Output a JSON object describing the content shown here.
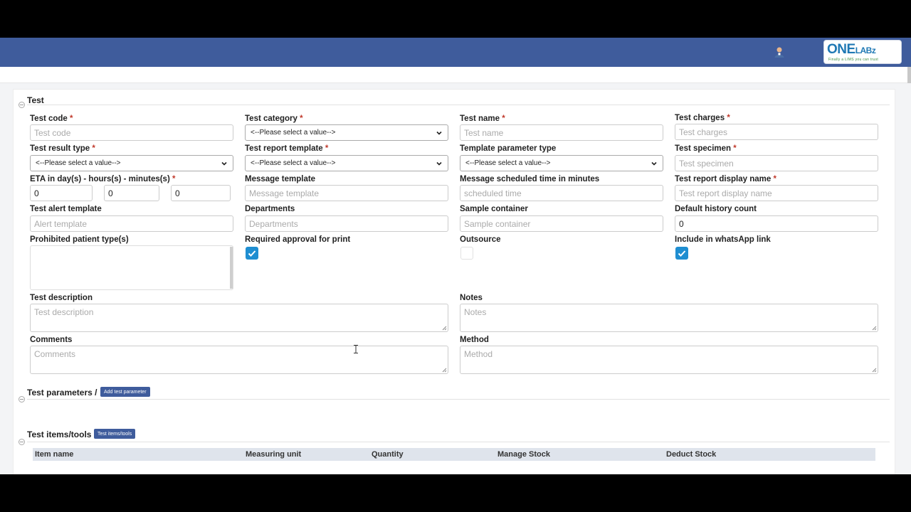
{
  "header": {
    "logo_text": "ONE",
    "logo_suffix": "LABz",
    "logo_tagline": "Finally a LIMS you can trust",
    "colors": {
      "topbar": "#3f5c9c",
      "accent": "#1f8ed1",
      "required": "#c0392b"
    }
  },
  "test_section": {
    "legend": "Test",
    "fields": {
      "test_code": {
        "label": "Test code",
        "placeholder": "Test code"
      },
      "test_category": {
        "label": "Test category",
        "value": "<--Please select a value-->"
      },
      "test_name": {
        "label": "Test name",
        "placeholder": "Test name"
      },
      "test_charges": {
        "label": "Test charges",
        "placeholder": "Test charges"
      },
      "test_result_type": {
        "label": "Test result type",
        "value": "<--Please select a value-->"
      },
      "test_report_template": {
        "label": "Test report template",
        "value": "<--Please select a value-->"
      },
      "template_parameter_type": {
        "label": "Template parameter type",
        "value": "<--Please select a value-->"
      },
      "test_specimen": {
        "label": "Test specimen",
        "placeholder": "Test specimen"
      },
      "eta": {
        "label": "ETA in day(s) - hours(s) - minutes(s)",
        "days": "0",
        "hours": "0",
        "minutes": "0"
      },
      "message_template": {
        "label": "Message template",
        "placeholder": "Message template"
      },
      "message_scheduled_time": {
        "label": "Message scheduled time in minutes",
        "placeholder": "scheduled time"
      },
      "test_report_display_name": {
        "label": "Test report display name",
        "placeholder": "Test report display name"
      },
      "test_alert_template": {
        "label": "Test alert template",
        "placeholder": "Alert template"
      },
      "departments": {
        "label": "Departments",
        "placeholder": "Departments"
      },
      "sample_container": {
        "label": "Sample container",
        "placeholder": "Sample container"
      },
      "default_history_count": {
        "label": "Default history count",
        "value": "0"
      },
      "prohibited_patient_types": {
        "label": "Prohibited patient type(s)"
      },
      "required_approval_for_print": {
        "label": "Required approval for print",
        "checked": true
      },
      "outsource": {
        "label": "Outsource",
        "checked": false
      },
      "include_in_whatsapp_link": {
        "label": "Include in whatsApp link",
        "checked": true
      },
      "test_description": {
        "label": "Test description",
        "placeholder": "Test description"
      },
      "notes": {
        "label": "Notes",
        "placeholder": "Notes"
      },
      "comments": {
        "label": "Comments",
        "placeholder": "Comments"
      },
      "method": {
        "label": "Method",
        "placeholder": "Method"
      }
    }
  },
  "test_parameters": {
    "legend": "Test parameters /",
    "add_button": "Add test parameter"
  },
  "test_items": {
    "legend": "Test items/tools",
    "button": "Test items/tools",
    "columns": [
      "Item name",
      "Measuring unit",
      "Quantity",
      "Manage Stock",
      "Deduct Stock"
    ]
  }
}
